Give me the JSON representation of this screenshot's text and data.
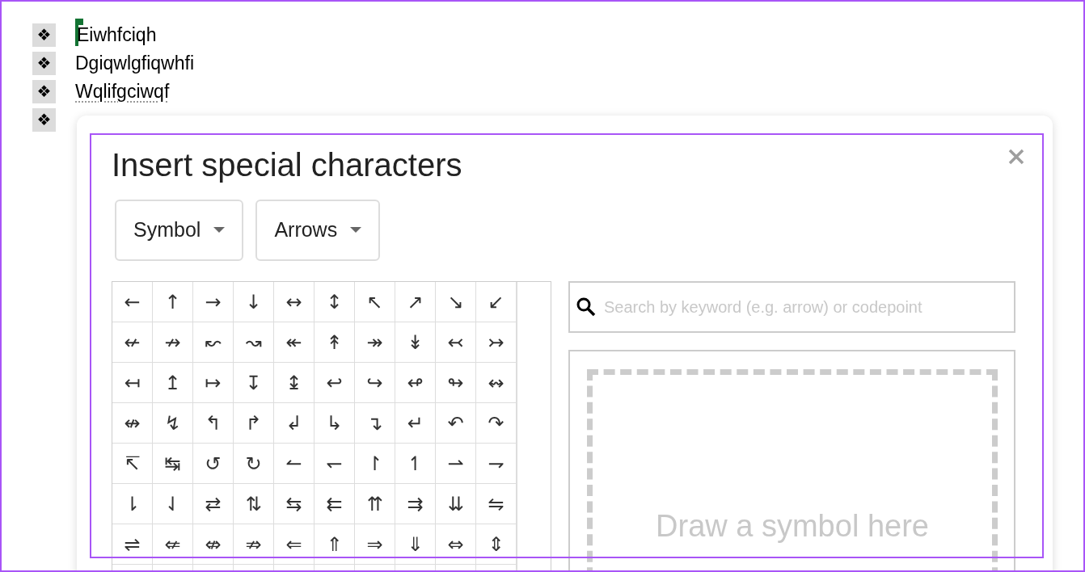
{
  "document": {
    "bullets": [
      {
        "marker": "❖",
        "text": "Eiwhfciqh",
        "cursor": true,
        "misspelled": false
      },
      {
        "marker": "❖",
        "text": "Dgiqwlgfiqwhfi",
        "cursor": false,
        "misspelled": false
      },
      {
        "marker": "❖",
        "text": "Wqlifgciwqf",
        "cursor": false,
        "misspelled": true
      },
      {
        "marker": "❖",
        "cursor": false,
        "misspelled": false
      }
    ]
  },
  "dialog": {
    "title": "Insert special characters",
    "dropdowns": [
      {
        "label": "Symbol"
      },
      {
        "label": "Arrows"
      }
    ],
    "characters": [
      [
        "←",
        "↑",
        "→",
        "↓",
        "↔",
        "↕",
        "↖",
        "↗",
        "↘",
        "↙"
      ],
      [
        "↚",
        "↛",
        "↜",
        "↝",
        "↞",
        "↟",
        "↠",
        "↡",
        "↢",
        "↣"
      ],
      [
        "↤",
        "↥",
        "↦",
        "↧",
        "↨",
        "↩",
        "↪",
        "↫",
        "↬",
        "↭"
      ],
      [
        "↮",
        "↯",
        "↰",
        "↱",
        "↲",
        "↳",
        "↴",
        "↵",
        "↶",
        "↷"
      ],
      [
        "↸",
        "↹",
        "↺",
        "↻",
        "↼",
        "↽",
        "↾",
        "↿",
        "⇀",
        "⇁"
      ],
      [
        "⇂",
        "⇃",
        "⇄",
        "⇅",
        "⇆",
        "⇇",
        "⇈",
        "⇉",
        "⇊",
        "⇋"
      ],
      [
        "⇌",
        "⇍",
        "⇎",
        "⇏",
        "⇐",
        "⇑",
        "⇒",
        "⇓",
        "⇔",
        "⇕"
      ]
    ],
    "search": {
      "placeholder": "Search by keyword (e.g. arrow) or codepoint"
    },
    "draw_area": {
      "hint": "Draw a symbol here"
    }
  }
}
